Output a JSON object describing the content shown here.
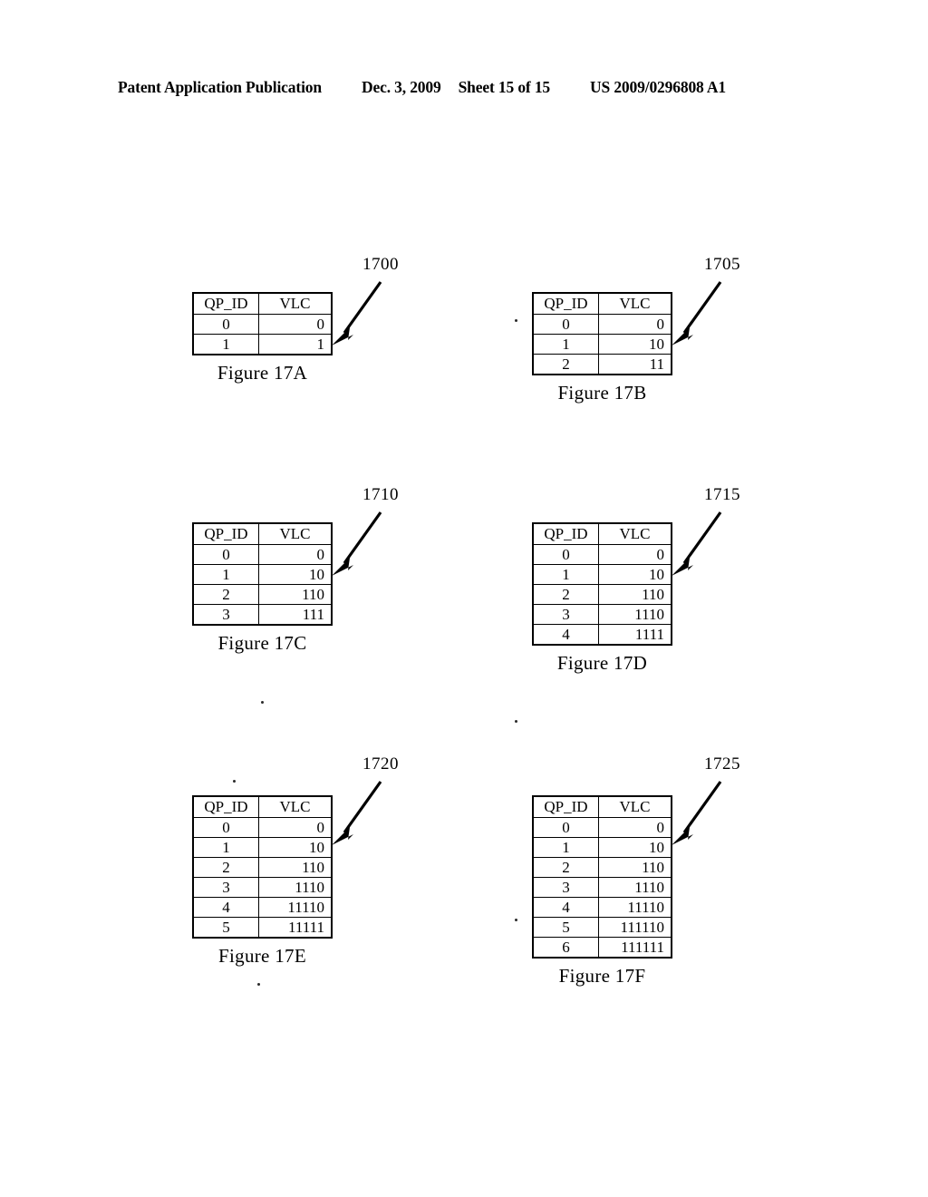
{
  "header": {
    "publication": "Patent Application Publication",
    "date": "Dec. 3, 2009",
    "sheet": "Sheet 15 of 15",
    "patent_number": "US 2009/0296808 A1"
  },
  "table_headers": {
    "qp_id": "QP_ID",
    "vlc": "VLC"
  },
  "figures": [
    {
      "id": "17a",
      "caption": "Figure 17A",
      "ref": "1700",
      "rows": [
        {
          "qp_id": "0",
          "vlc": "0"
        },
        {
          "qp_id": "1",
          "vlc": "1"
        }
      ]
    },
    {
      "id": "17b",
      "caption": "Figure 17B",
      "ref": "1705",
      "rows": [
        {
          "qp_id": "0",
          "vlc": "0"
        },
        {
          "qp_id": "1",
          "vlc": "10"
        },
        {
          "qp_id": "2",
          "vlc": "11"
        }
      ]
    },
    {
      "id": "17c",
      "caption": "Figure 17C",
      "ref": "1710",
      "rows": [
        {
          "qp_id": "0",
          "vlc": "0"
        },
        {
          "qp_id": "1",
          "vlc": "10"
        },
        {
          "qp_id": "2",
          "vlc": "110"
        },
        {
          "qp_id": "3",
          "vlc": "111"
        }
      ]
    },
    {
      "id": "17d",
      "caption": "Figure 17D",
      "ref": "1715",
      "rows": [
        {
          "qp_id": "0",
          "vlc": "0"
        },
        {
          "qp_id": "1",
          "vlc": "10"
        },
        {
          "qp_id": "2",
          "vlc": "110"
        },
        {
          "qp_id": "3",
          "vlc": "1110"
        },
        {
          "qp_id": "4",
          "vlc": "1111"
        }
      ]
    },
    {
      "id": "17e",
      "caption": "Figure 17E",
      "ref": "1720",
      "rows": [
        {
          "qp_id": "0",
          "vlc": "0"
        },
        {
          "qp_id": "1",
          "vlc": "10"
        },
        {
          "qp_id": "2",
          "vlc": "110"
        },
        {
          "qp_id": "3",
          "vlc": "1110"
        },
        {
          "qp_id": "4",
          "vlc": "11110"
        },
        {
          "qp_id": "5",
          "vlc": "11111"
        }
      ]
    },
    {
      "id": "17f",
      "caption": "Figure 17F",
      "ref": "1725",
      "rows": [
        {
          "qp_id": "0",
          "vlc": "0"
        },
        {
          "qp_id": "1",
          "vlc": "10"
        },
        {
          "qp_id": "2",
          "vlc": "110"
        },
        {
          "qp_id": "3",
          "vlc": "1110"
        },
        {
          "qp_id": "4",
          "vlc": "11110"
        },
        {
          "qp_id": "5",
          "vlc": "111110"
        },
        {
          "qp_id": "6",
          "vlc": "111111"
        }
      ]
    }
  ]
}
